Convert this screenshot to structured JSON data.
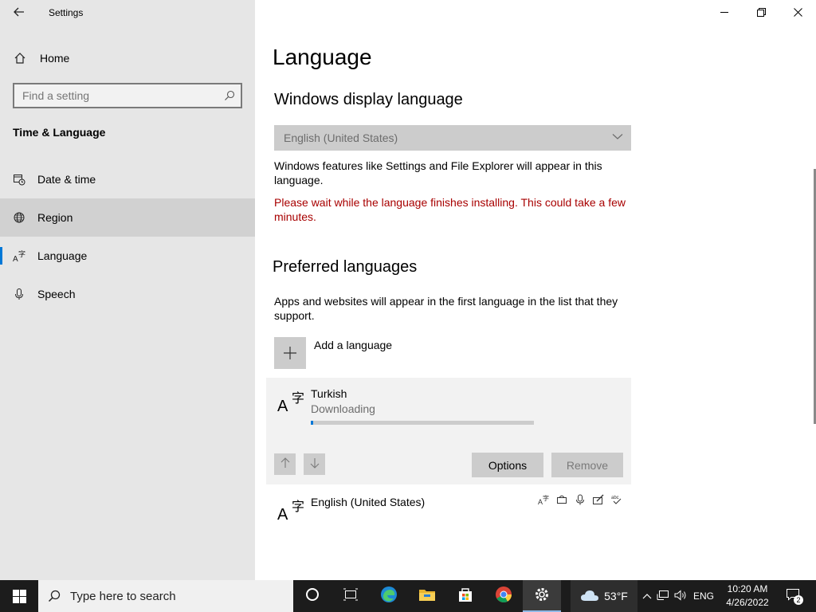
{
  "window": {
    "app_title": "Settings",
    "back_icon": "arrow-left-icon",
    "minimize_glyph": "—",
    "maximize_glyph": "❐",
    "close_glyph": "✕"
  },
  "sidebar": {
    "home_label": "Home",
    "search_placeholder": "Find a setting",
    "section_title": "Time & Language",
    "items": [
      {
        "label": "Date & time",
        "icon": "calendar-clock-icon"
      },
      {
        "label": "Region",
        "icon": "globe-icon"
      },
      {
        "label": "Language",
        "icon": "language-icon",
        "selected": true
      },
      {
        "label": "Speech",
        "icon": "microphone-icon"
      }
    ]
  },
  "main": {
    "page_title": "Language",
    "display_language": {
      "heading": "Windows display language",
      "selected_value": "English (United States)",
      "description": "Windows features like Settings and File Explorer will appear in this language.",
      "warning": "Please wait while the language finishes installing. This could take a few minutes."
    },
    "preferred": {
      "heading": "Preferred languages",
      "description": "Apps and websites will appear in the first language in the list that they support.",
      "add_label": "Add a language",
      "languages": [
        {
          "name": "Turkish",
          "status": "Downloading",
          "progress": 0.01
        },
        {
          "name": "English (United States)"
        }
      ],
      "options_label": "Options",
      "remove_label": "Remove"
    }
  },
  "taskbar": {
    "search_placeholder": "Type here to search",
    "weather_temp": "53°F",
    "input_language": "ENG",
    "time": "10:20 AM",
    "date": "4/26/2022",
    "notification_count": "2"
  },
  "colors": {
    "accent": "#0078d7",
    "warning": "#a80000",
    "sidebar_bg": "#e6e6e6",
    "taskbar_bg": "#1c1c1c"
  }
}
